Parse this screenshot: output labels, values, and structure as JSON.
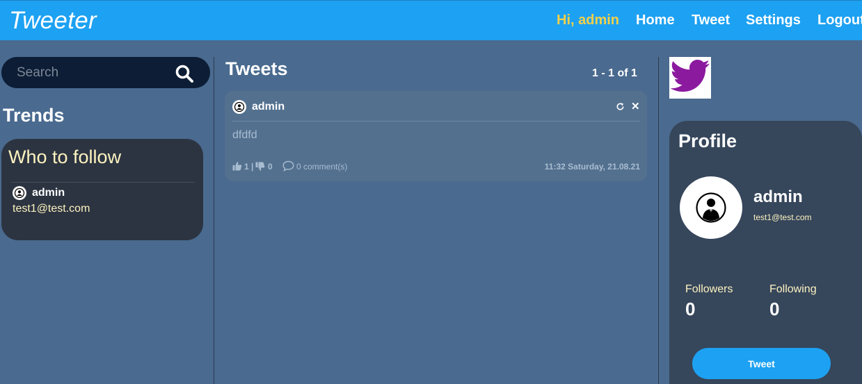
{
  "brand": "Tweeter",
  "nav": {
    "greeting": "Hi, admin",
    "home": "Home",
    "tweet": "Tweet",
    "settings": "Settings",
    "logout": "Logout"
  },
  "search": {
    "placeholder": "Search",
    "icon": "search-icon"
  },
  "trends": {
    "title": "Trends"
  },
  "who_to_follow": {
    "title": "Who to follow",
    "users": [
      {
        "name": "admin",
        "email": "test1@test.com"
      }
    ]
  },
  "feed": {
    "title": "Tweets",
    "paging": "1 - 1 of 1",
    "tweets": [
      {
        "user": "admin",
        "body": "dfdfd",
        "likes": "1",
        "separator": "|",
        "dislikes": "0",
        "comments": "0 comment(s)",
        "timestamp": "11:32 Saturday, 21.08.21"
      }
    ]
  },
  "profile": {
    "title": "Profile",
    "name": "admin",
    "email": "test1@test.com",
    "followers_label": "Followers",
    "followers": "0",
    "following_label": "Following",
    "following": "0",
    "tweet_button": "Tweet"
  },
  "colors": {
    "header": "#1da1f2",
    "background": "#4a6a8f",
    "greeting": "#f2d04a",
    "card_dark": "#2c3441",
    "profile_card": "#36465b",
    "bird": "#8b1a9e"
  }
}
